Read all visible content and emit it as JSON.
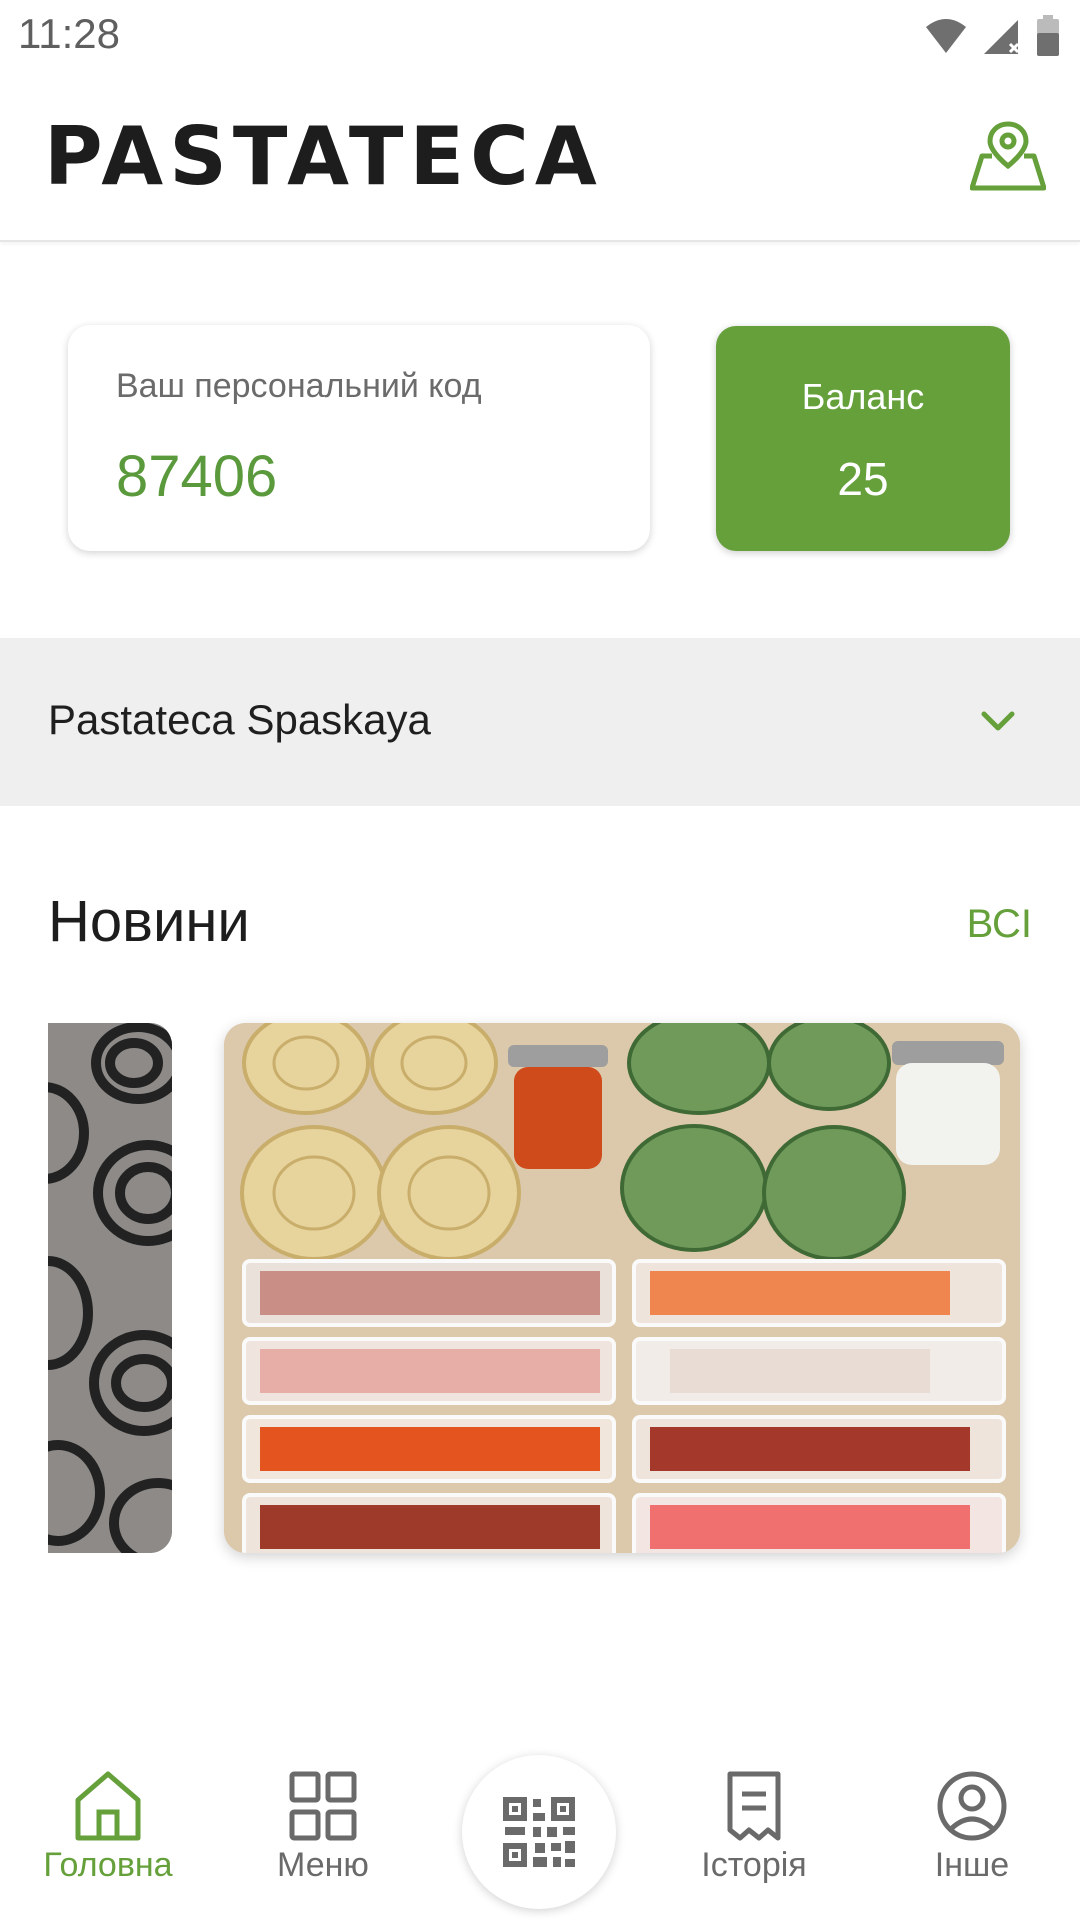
{
  "status_bar": {
    "time": "11:28"
  },
  "header": {
    "logo": "PASTATECA",
    "map_icon": "map-pin-icon"
  },
  "code_card": {
    "label": "Ваш персональний код",
    "value": "87406"
  },
  "balance_card": {
    "label": "Баланс",
    "value": "25"
  },
  "location": {
    "selected": "Pastateca Spaskaya"
  },
  "news": {
    "title": "Новини",
    "all_link": "ВСІ"
  },
  "bottom_nav": {
    "items": [
      {
        "label": "Головна",
        "icon": "home-icon",
        "active": true
      },
      {
        "label": "Меню",
        "icon": "grid-icon",
        "active": false
      },
      {
        "label": "",
        "icon": "qr-code-icon",
        "active": false
      },
      {
        "label": "Історія",
        "icon": "receipt-icon",
        "active": false
      },
      {
        "label": "Інше",
        "icon": "profile-icon",
        "active": false
      }
    ]
  },
  "colors": {
    "accent": "#65a03b",
    "background": "#ffffff",
    "location_bar": "#efefef"
  }
}
